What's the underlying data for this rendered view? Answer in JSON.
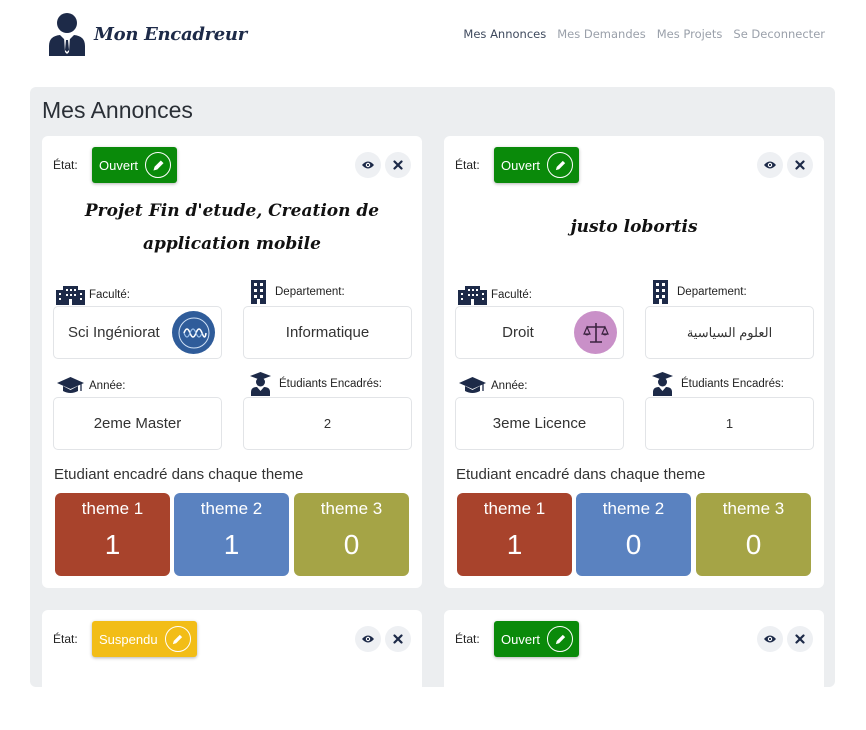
{
  "brand": {
    "name": "Mon Encadreur"
  },
  "nav": [
    {
      "label": "Mes Annonces",
      "active": true
    },
    {
      "label": "Mes Demandes",
      "active": false
    },
    {
      "label": "Mes Projets",
      "active": false
    },
    {
      "label": "Se Deconnecter",
      "active": false
    }
  ],
  "page": {
    "title": "Mes Annonces"
  },
  "labels": {
    "etat": "État:",
    "faculte": "Faculté:",
    "departement": "Departement:",
    "annee": "Année:",
    "etudiants": "Étudiants Encadrés:",
    "themes_heading": "Etudiant encadré dans chaque theme"
  },
  "cards": [
    {
      "status": "Ouvert",
      "status_color": "#0a8a0a",
      "title": "Projet Fin d'etude, Creation de application mobile",
      "faculte": "Sci Ingéniorat",
      "faculte_icon": "engineering-badge-icon",
      "faculte_badge_color": "#2f5c9a",
      "departement": "Informatique",
      "annee": "2eme Master",
      "etudiants": "2",
      "themes": [
        {
          "name": "theme 1",
          "value": "1",
          "color": "#a8432c"
        },
        {
          "name": "theme 2",
          "value": "1",
          "color": "#5a82c0"
        },
        {
          "name": "theme 3",
          "value": "0",
          "color": "#a5a446"
        }
      ]
    },
    {
      "status": "Ouvert",
      "status_color": "#0a8a0a",
      "title": "justo lobortis",
      "faculte": "Droit",
      "faculte_icon": "scales-of-justice-icon",
      "faculte_badge_color": "#c990c8",
      "departement": "العلوم السياسية",
      "annee": "3eme Licence",
      "etudiants": "1",
      "themes": [
        {
          "name": "theme 1",
          "value": "1",
          "color": "#a8432c"
        },
        {
          "name": "theme 2",
          "value": "0",
          "color": "#5a82c0"
        },
        {
          "name": "theme 3",
          "value": "0",
          "color": "#a5a446"
        }
      ]
    },
    {
      "status": "Suspendu",
      "status_color": "#f2bd17"
    },
    {
      "status": "Ouvert",
      "status_color": "#0a8a0a"
    }
  ]
}
